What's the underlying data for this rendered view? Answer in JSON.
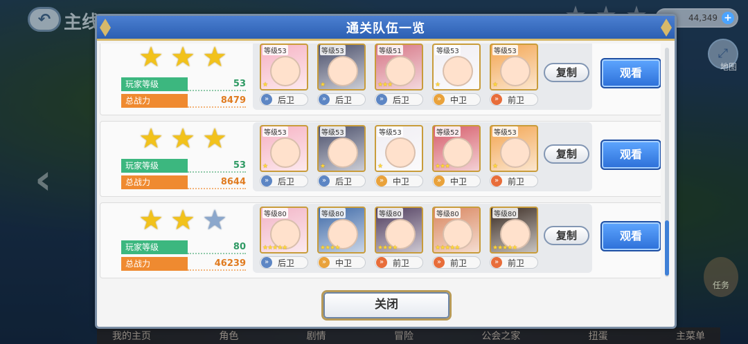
{
  "background": {
    "title": "主线",
    "currency": "44,349",
    "map_label": "地图",
    "task_label": "任务",
    "nav": [
      "我的主页",
      "角色",
      "剧情",
      "冒险",
      "公会之家",
      "扭蛋",
      "主菜单"
    ]
  },
  "modal": {
    "title": "通关队伍一览",
    "close_label": "关闭",
    "copy_label": "复制",
    "view_label": "观看"
  },
  "teams": [
    {
      "stars": [
        "gold",
        "gold",
        "gold"
      ],
      "player_level_label": "玩家等级",
      "player_level": "53",
      "power_label": "总战力",
      "power": "8479",
      "units": [
        {
          "level": "等级53",
          "stars": "★",
          "position": "后卫",
          "pos_type": "back",
          "color": "#f6b2c3"
        },
        {
          "level": "等级53",
          "stars": "★",
          "position": "后卫",
          "pos_type": "back",
          "color": "#4a4f6b"
        },
        {
          "level": "等级51",
          "stars": "★★★",
          "position": "后卫",
          "pos_type": "back",
          "color": "#d67585"
        },
        {
          "level": "等级53",
          "stars": "★",
          "position": "中卫",
          "pos_type": "mid",
          "color": "#f0eef3"
        },
        {
          "level": "等级53",
          "stars": "★",
          "position": "前卫",
          "pos_type": "front",
          "color": "#f3a653"
        }
      ]
    },
    {
      "stars": [
        "gold",
        "gold",
        "gold"
      ],
      "player_level_label": "玩家等级",
      "player_level": "53",
      "power_label": "总战力",
      "power": "8644",
      "units": [
        {
          "level": "等级53",
          "stars": "★",
          "position": "后卫",
          "pos_type": "back",
          "color": "#f6b2c3"
        },
        {
          "level": "等级53",
          "stars": "★",
          "position": "后卫",
          "pos_type": "back",
          "color": "#4a4f6b"
        },
        {
          "level": "等级53",
          "stars": "★",
          "position": "中卫",
          "pos_type": "mid",
          "color": "#f0eef3"
        },
        {
          "level": "等级52",
          "stars": "★★★",
          "position": "中卫",
          "pos_type": "mid",
          "color": "#d65c6a"
        },
        {
          "level": "等级53",
          "stars": "★",
          "position": "前卫",
          "pos_type": "front",
          "color": "#f3a653"
        }
      ]
    },
    {
      "stars": [
        "gold",
        "gold",
        "blue"
      ],
      "player_level_label": "玩家等级",
      "player_level": "80",
      "power_label": "总战力",
      "power": "46239",
      "units": [
        {
          "level": "等级80",
          "stars": "★★★★★",
          "position": "后卫",
          "pos_type": "back",
          "color": "#f2b4c6"
        },
        {
          "level": "等级80",
          "stars": "★★★★",
          "position": "中卫",
          "pos_type": "mid",
          "color": "#3f6aa8"
        },
        {
          "level": "等级80",
          "stars": "★★★★",
          "position": "前卫",
          "pos_type": "front",
          "color": "#4e3b5d"
        },
        {
          "level": "等级80",
          "stars": "★★★★★",
          "position": "前卫",
          "pos_type": "front",
          "color": "#d9865f"
        },
        {
          "level": "等级80",
          "stars": "★★★★★",
          "position": "前卫",
          "pos_type": "front",
          "color": "#3a2b22"
        }
      ]
    }
  ]
}
